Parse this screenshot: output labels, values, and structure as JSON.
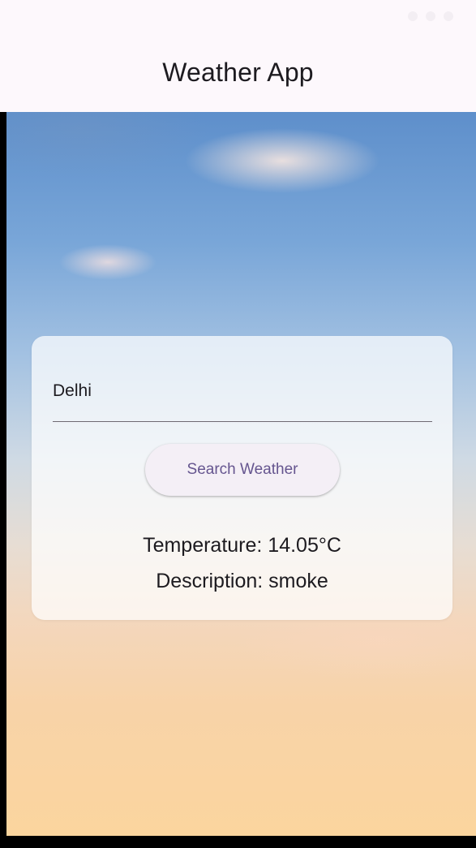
{
  "app_bar": {
    "title": "Weather App"
  },
  "search": {
    "city_value": "Delhi",
    "button_label": "Search Weather"
  },
  "result": {
    "temperature_text": "Temperature: 14.05°C",
    "description_text": "Description: smoke"
  },
  "colors": {
    "app_bar_bg": "#fdf8fc",
    "button_text": "#65558f",
    "button_bg": "#f4eff6",
    "text_primary": "#1d1b20"
  }
}
